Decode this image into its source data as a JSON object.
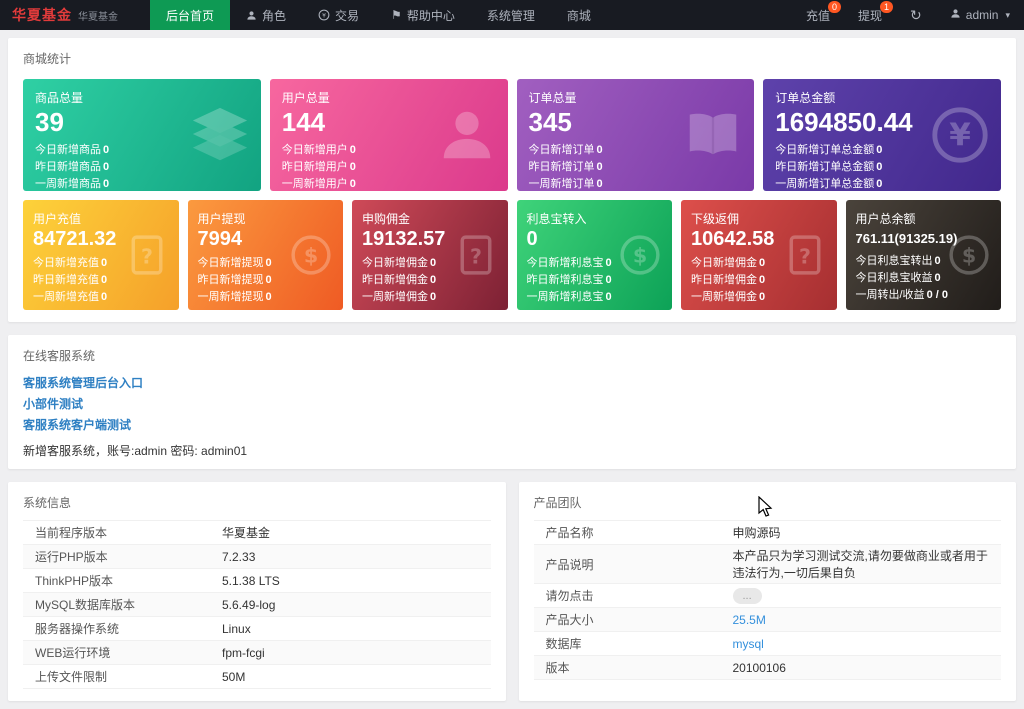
{
  "colors": {
    "navbar_bg": "#181b22",
    "nav_active_green": "#0e9a54",
    "badge_orange": "#ff5722",
    "link_blue": "#3490dc",
    "brand_red": "#e23b3b"
  },
  "icons": {
    "flag": "⚑",
    "refresh": "↻",
    "caret": "▾"
  },
  "navbar": {
    "brand": "华夏基金",
    "brand_sub": "华夏基金",
    "menu": [
      {
        "label": "后台首页"
      },
      {
        "label": "角色"
      },
      {
        "label": "交易"
      },
      {
        "label": "帮助中心"
      },
      {
        "label": "系统管理"
      },
      {
        "label": "商城"
      }
    ],
    "recharge": {
      "label": "充值",
      "badge": "0"
    },
    "withdraw": {
      "label": "提现",
      "badge": "1"
    },
    "admin": {
      "label": "admin"
    }
  },
  "stats": {
    "title": "商城统计",
    "row1": [
      {
        "title": "商品总量",
        "value": "39",
        "icon": "layers-icon",
        "gradient": [
          "#2fd0a4",
          "#12a381"
        ],
        "lines": [
          [
            "今日新增商品",
            "0"
          ],
          [
            "昨日新增商品",
            "0"
          ],
          [
            "一周新增商品",
            "0"
          ]
        ]
      },
      {
        "title": "用户总量",
        "value": "144",
        "icon": "user-icon",
        "gradient": [
          "#f7679f",
          "#db3a8c"
        ],
        "lines": [
          [
            "今日新增用户",
            "0"
          ],
          [
            "昨日新增用户",
            "0"
          ],
          [
            "一周新增用户",
            "0"
          ]
        ]
      },
      {
        "title": "订单总量",
        "value": "345",
        "icon": "book-icon",
        "gradient": [
          "#a15fc0",
          "#7a3aa8"
        ],
        "lines": [
          [
            "今日新增订单",
            "0"
          ],
          [
            "昨日新增订单",
            "0"
          ],
          [
            "一周新增订单",
            "0"
          ]
        ]
      },
      {
        "title": "订单总金额",
        "value": "1694850.44",
        "icon": "yen-circle-icon",
        "gradient": [
          "#5e42ab",
          "#41288c"
        ],
        "lines": [
          [
            "今日新增订单总金额",
            "0"
          ],
          [
            "昨日新增订单总金额",
            "0"
          ],
          [
            "一周新增订单总金额",
            "0"
          ]
        ]
      }
    ],
    "row2": [
      {
        "title": "用户充值",
        "value": "84721.32",
        "icon": "question-clipboard-icon",
        "gradient": [
          "#fdd23a",
          "#f5a02a"
        ],
        "lines": [
          [
            "今日新增充值",
            "0"
          ],
          [
            "昨日新增充值",
            "0"
          ],
          [
            "一周新增充值",
            "0"
          ]
        ]
      },
      {
        "title": "用户提现",
        "value": "7994",
        "icon": "dollar-circle-icon",
        "gradient": [
          "#fb9a3f",
          "#ef5b24"
        ],
        "lines": [
          [
            "今日新增提现",
            "0"
          ],
          [
            "昨日新增提现",
            "0"
          ],
          [
            "一周新增提现",
            "0"
          ]
        ]
      },
      {
        "title": "申购佣金",
        "value": "19132.57",
        "icon": "question-clipboard-icon",
        "gradient": [
          "#cf4a58",
          "#7d2134"
        ],
        "lines": [
          [
            "今日新增佣金",
            "0"
          ],
          [
            "昨日新增佣金",
            "0"
          ],
          [
            "一周新增佣金",
            "0"
          ]
        ]
      },
      {
        "title": "利息宝转入",
        "value": "0",
        "icon": "dollar-circle-icon",
        "gradient": [
          "#3fd37a",
          "#0da257"
        ],
        "lines": [
          [
            "今日新增利息宝",
            "0"
          ],
          [
            "昨日新增利息宝",
            "0"
          ],
          [
            "一周新增利息宝",
            "0"
          ]
        ]
      },
      {
        "title": "下级返佣",
        "value": "10642.58",
        "icon": "question-clipboard-icon",
        "gradient": [
          "#dd4f4b",
          "#a62f31"
        ],
        "lines": [
          [
            "今日新增佣金",
            "0"
          ],
          [
            "昨日新增佣金",
            "0"
          ],
          [
            "一周新增佣金",
            "0"
          ]
        ]
      },
      {
        "title": "用户总余额",
        "value": "761.11(91325.19)",
        "icon": "dollar-circle-icon",
        "gradient": [
          "#4a433b",
          "#211d1a"
        ],
        "lines": [
          [
            "今日利息宝转出",
            "0"
          ],
          [
            "今日利息宝收益",
            "0"
          ],
          [
            "一周转出/收益",
            "0 / 0"
          ]
        ]
      }
    ]
  },
  "service": {
    "title": "在线客服系统",
    "links": [
      "客服系统管理后台入口",
      "小部件测试",
      "客服系统客户端测试"
    ],
    "note": "新增客服系统，账号:admin 密码: admin01"
  },
  "system_info": {
    "title": "系统信息",
    "rows": [
      {
        "label": "当前程序版本",
        "value": "华夏基金"
      },
      {
        "label": "运行PHP版本",
        "value": "7.2.33"
      },
      {
        "label": "ThinkPHP版本",
        "value": "5.1.38 LTS"
      },
      {
        "label": "MySQL数据库版本",
        "value": "5.6.49-log"
      },
      {
        "label": "服务器操作系统",
        "value": "Linux"
      },
      {
        "label": "WEB运行环境",
        "value": "fpm-fcgi"
      },
      {
        "label": "上传文件限制",
        "value": "50M"
      }
    ]
  },
  "product_team": {
    "title": "产品团队",
    "rows": [
      {
        "label": "产品名称",
        "value": "申购源码"
      },
      {
        "label": "产品说明",
        "value": "本产品只为学习测试交流,请勿要做商业或者用于违法行为,一切后果自负"
      },
      {
        "label": "请勿点击",
        "value": "..."
      },
      {
        "label": "产品大小",
        "value": "25.5M"
      },
      {
        "label": "数据库",
        "value": "mysql"
      },
      {
        "label": "版本",
        "value": "20100106"
      }
    ]
  }
}
